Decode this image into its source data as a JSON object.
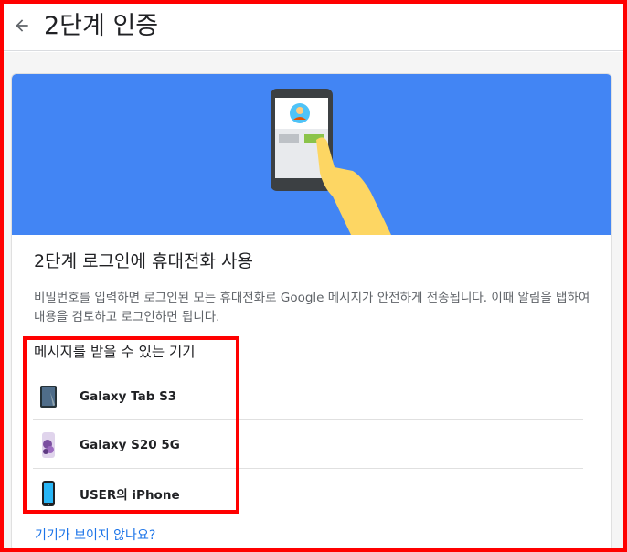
{
  "header": {
    "title": "2단계 인증",
    "back_icon": "arrow-left-icon"
  },
  "card": {
    "heading": "2단계 로그인에 휴대전화 사용",
    "description": "비밀번호를 입력하면 로그인된 모든 휴대전화로 Google 메시지가 안전하게 전송됩니다. 이때 알림을 탭하여 내용을 검토하고 로그인하면 됩니다.",
    "devices_label": "메시지를 받을 수 있는 기기",
    "devices": [
      {
        "name": "Galaxy Tab S3",
        "icon": "tablet-icon"
      },
      {
        "name": "Galaxy S20 5G",
        "icon": "phone-icon"
      },
      {
        "name": "USER의 iPhone",
        "icon": "iphone-icon"
      }
    ],
    "help_link": "기기가 보이지 않나요?"
  },
  "colors": {
    "banner": "#4285f4",
    "link": "#1a73e8",
    "annotation": "#ff0000"
  }
}
